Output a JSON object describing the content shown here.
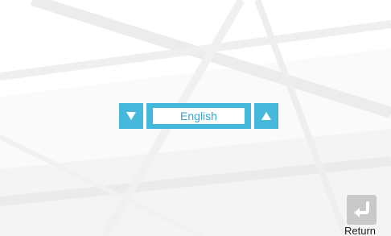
{
  "language_selector": {
    "value": "English",
    "down_icon": "triangle-down-icon",
    "up_icon": "triangle-up-icon"
  },
  "return_button": {
    "label": "Return",
    "icon": "return-arrow-icon"
  },
  "colors": {
    "accent": "#46b8dc",
    "value_text": "#2ea7d4",
    "return_icon_bg": "#c9c9c9",
    "background": "#fafafa"
  }
}
